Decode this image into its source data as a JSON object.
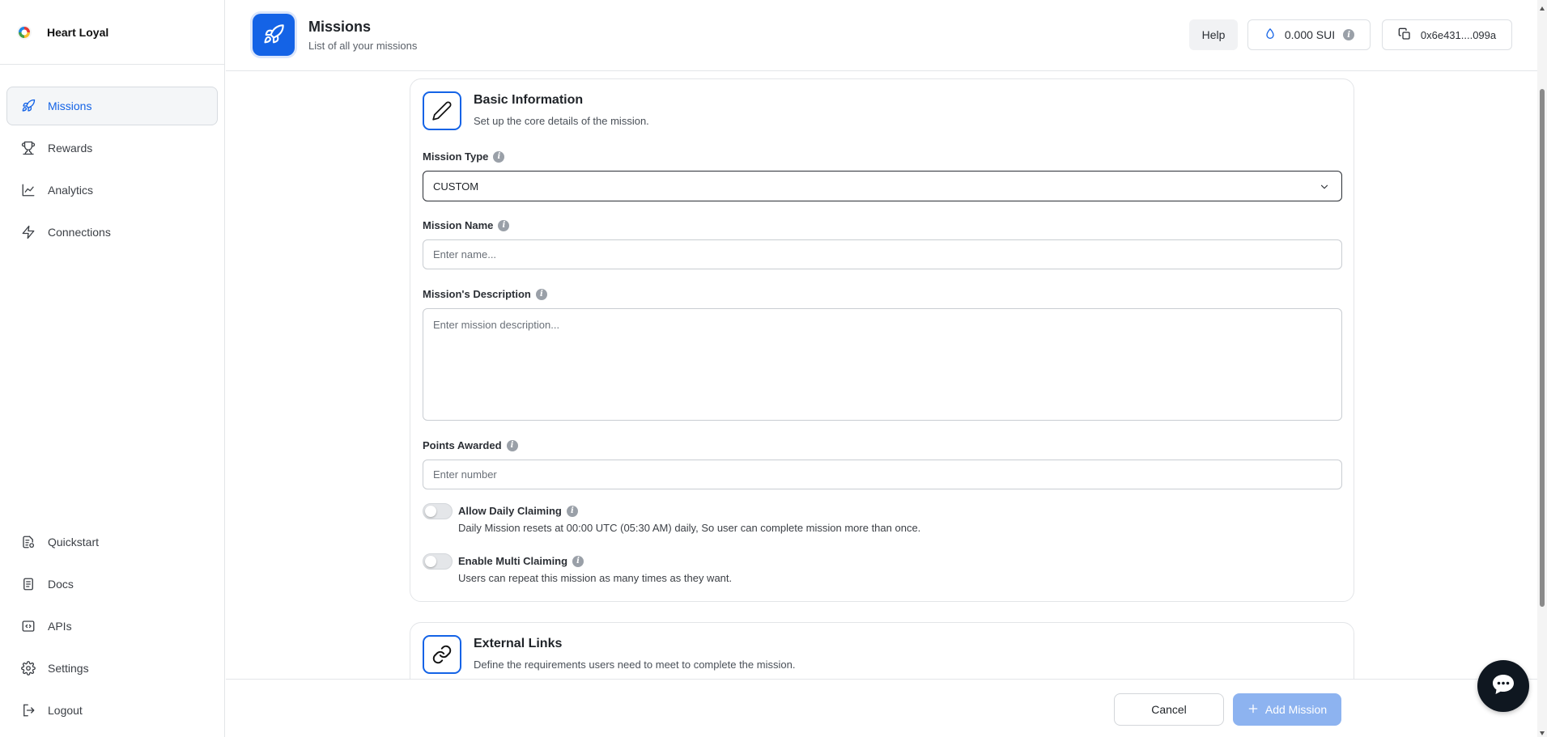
{
  "brand": {
    "name": "Heart Loyal"
  },
  "sidebar": {
    "items": [
      {
        "label": "Missions",
        "icon": "rocket-icon",
        "active": true
      },
      {
        "label": "Rewards",
        "icon": "trophy-icon"
      },
      {
        "label": "Analytics",
        "icon": "chart-line-icon"
      },
      {
        "label": "Connections",
        "icon": "bolt-icon"
      }
    ],
    "bottom_items": [
      {
        "label": "Quickstart",
        "icon": "quickstart-icon"
      },
      {
        "label": "Docs",
        "icon": "docs-icon"
      },
      {
        "label": "APIs",
        "icon": "code-icon"
      },
      {
        "label": "Settings",
        "icon": "gear-icon"
      },
      {
        "label": "Logout",
        "icon": "logout-icon"
      }
    ]
  },
  "header": {
    "title": "Missions",
    "subtitle": "List of all your missions",
    "help_label": "Help",
    "balance": "0.000 SUI",
    "wallet": "0x6e431....099a"
  },
  "basic_info": {
    "title": "Basic Information",
    "description": "Set up the core details of the mission.",
    "mission_type_label": "Mission Type",
    "mission_type_value": "CUSTOM",
    "mission_name_label": "Mission Name",
    "mission_name_placeholder": "Enter name...",
    "description_label": "Mission's Description",
    "description_placeholder": "Enter mission description...",
    "points_label": "Points Awarded",
    "points_placeholder": "Enter number",
    "daily_title": "Allow Daily Claiming",
    "daily_desc": "Daily Mission resets at 00:00 UTC (05:30 AM) daily, So user can complete mission more than once.",
    "multi_title": "Enable Multi Claiming",
    "multi_desc": "Users can repeat this mission as many times as they want."
  },
  "external_links": {
    "title": "External Links",
    "description": "Define the requirements users need to meet to complete the mission."
  },
  "footer": {
    "cancel_label": "Cancel",
    "add_label": "Add Mission"
  },
  "colors": {
    "accent": "#1463e6",
    "add_button_disabled": "#8db3f0"
  }
}
